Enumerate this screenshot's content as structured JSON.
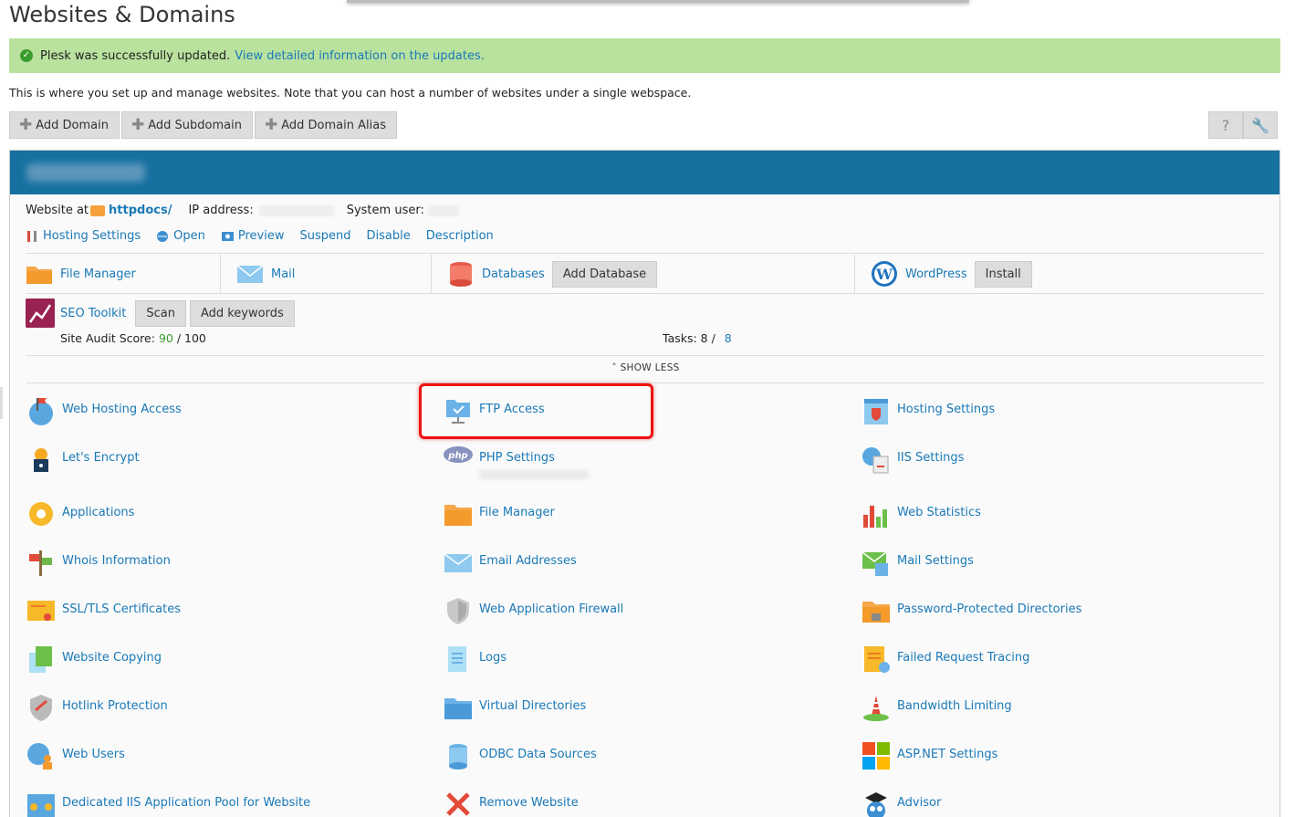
{
  "page_title": "Websites & Domains",
  "message": {
    "text": "Plesk was successfully updated.",
    "link": "View detailed information on the updates."
  },
  "intro": "This is where you set up and manage websites. Note that you can host a number of websites under a single webspace.",
  "toolbar": {
    "add_domain": "Add Domain",
    "add_subdomain": "Add Subdomain",
    "add_alias": "Add Domain Alias",
    "help": "?"
  },
  "site": {
    "website_at": "Website at",
    "folder": "httpdocs/",
    "ip_label": "IP address:",
    "sysuser_label": "System user:"
  },
  "actions": [
    "Hosting Settings",
    "Open",
    "Preview",
    "Suspend",
    "Disable",
    "Description"
  ],
  "tools": {
    "file_manager": "File Manager",
    "mail": "Mail",
    "databases": "Databases",
    "add_database": "Add Database",
    "wordpress": "WordPress",
    "install": "Install"
  },
  "seo": {
    "label": "SEO Toolkit",
    "scan": "Scan",
    "add_keywords": "Add keywords"
  },
  "audit": {
    "label": "Site Audit Score:",
    "score": "90",
    "max": "/ 100",
    "tasks_label": "Tasks: 8 /",
    "tasks_link": "8"
  },
  "show_less": "SHOW LESS",
  "grid": {
    "col1": [
      "Web Hosting Access",
      "Let's Encrypt",
      "Applications",
      "Whois Information",
      "SSL/TLS Certificates",
      "Website Copying",
      "Hotlink Protection",
      "Web Users",
      "Dedicated IIS Application Pool for Website"
    ],
    "col2": [
      "FTP Access",
      "PHP Settings",
      "File Manager",
      "Email Addresses",
      "Web Application Firewall",
      "Logs",
      "Virtual Directories",
      "ODBC Data Sources",
      "Remove Website"
    ],
    "col3": [
      "Hosting Settings",
      "IIS Settings",
      "Web Statistics",
      "Mail Settings",
      "Password-Protected Directories",
      "Failed Request Tracing",
      "Bandwidth Limiting",
      "ASP.NET Settings",
      "Advisor"
    ]
  },
  "colors": {
    "header": "#1670a0",
    "success_bg": "#b9e29f",
    "link": "#1a79b8",
    "highlight": "#e11111"
  }
}
